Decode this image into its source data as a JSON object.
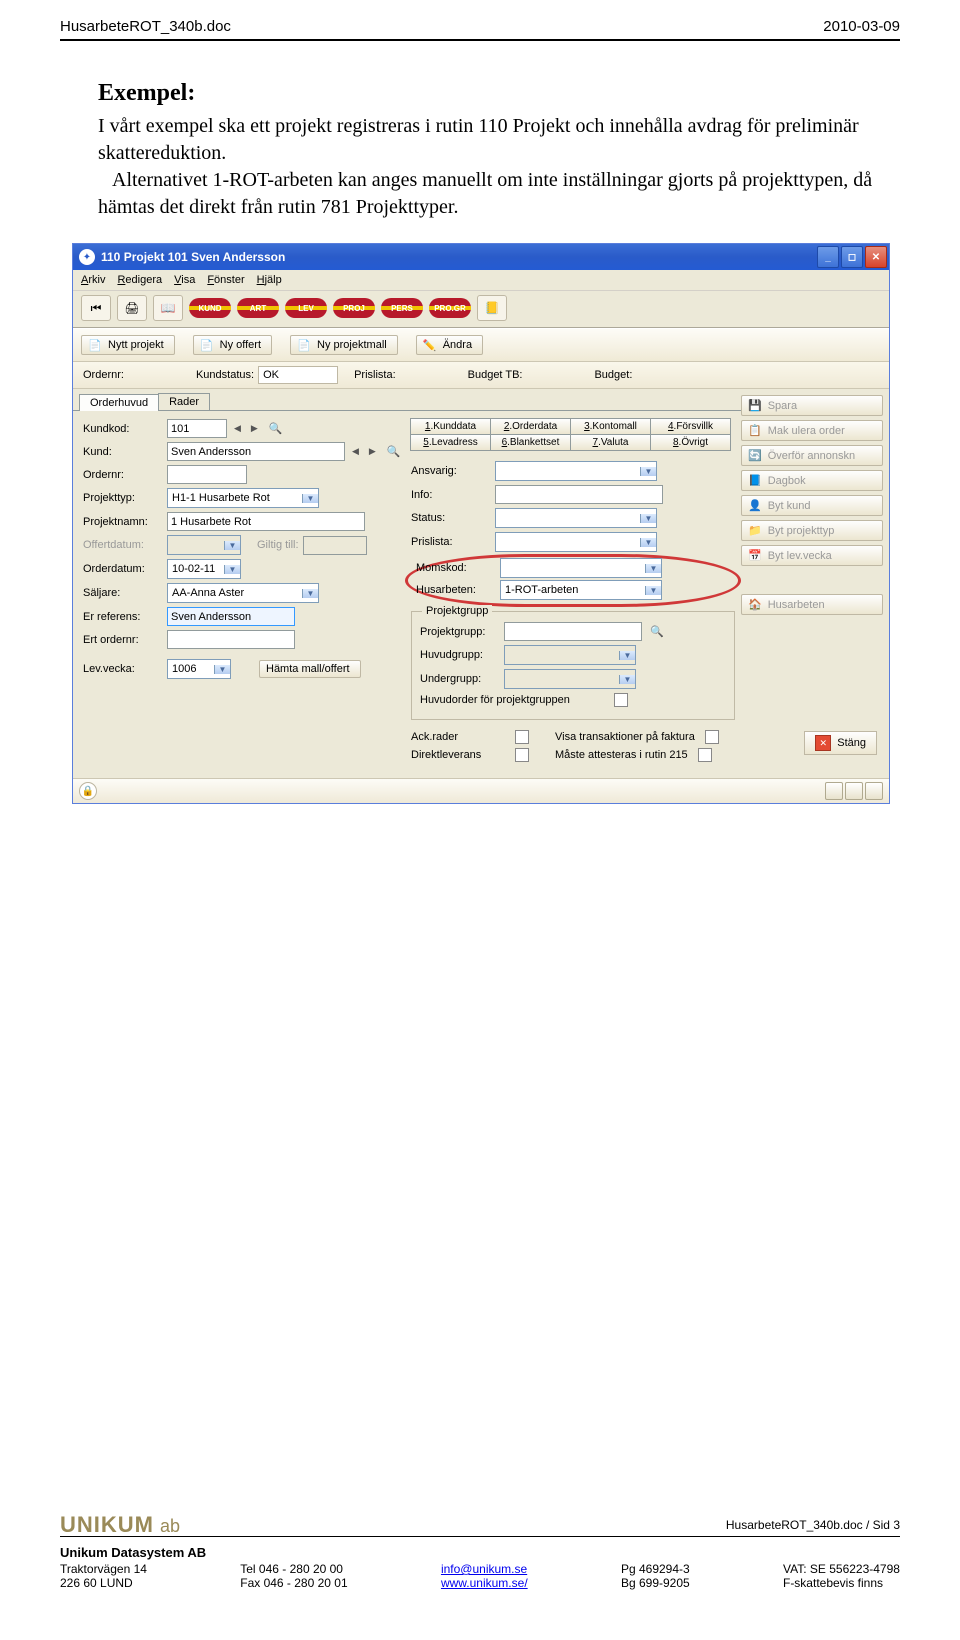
{
  "header": {
    "left": "HusarbeteROT_340b.doc",
    "right": "2010-03-09"
  },
  "text": {
    "heading": "Exempel:",
    "p1": "I vårt exempel ska ett projekt registreras i rutin 110 Projekt och innehålla avdrag för preliminär skattereduktion.",
    "p2a": "Alternativet 1-ROT-arbeten kan anges manuellt om inte inställningar gjorts på projekttypen, då hämtas det direkt från rutin 781 Projekttyper."
  },
  "window": {
    "title": "110 Projekt  101  Sven Andersson",
    "menu": [
      "Arkiv",
      "Redigera",
      "Visa",
      "Fönster",
      "Hjälp"
    ],
    "pills": [
      "KUND",
      "ART",
      "LEV",
      "PROJ",
      "PERS",
      "PRO.GR"
    ],
    "toolbar_buttons": [
      {
        "icon": "📄",
        "label": "Nytt projekt"
      },
      {
        "icon": "📄",
        "label": "Ny offert"
      },
      {
        "icon": "📄",
        "label": "Ny projektmall"
      },
      {
        "icon": "✏️",
        "label": "Ändra"
      }
    ],
    "meta": {
      "ordernr_label": "Ordernr:",
      "kundstatus_label": "Kundstatus:",
      "kundstatus": "OK",
      "prislista_label": "Prislista:",
      "budgettb_label": "Budget TB:",
      "budget_label": "Budget:"
    },
    "tabs": [
      "Orderhuvud",
      "Rader"
    ],
    "left": {
      "kundkod_label": "Kundkod:",
      "kundkod": "101",
      "kund_label": "Kund:",
      "kund": "Sven Andersson",
      "ordernr_label": "Ordernr:",
      "projekttyp_label": "Projekttyp:",
      "projekttyp": "H1-1 Husarbete Rot",
      "projektnamn_label": "Projektnamn:",
      "projektnamn": "1 Husarbete Rot",
      "offertdatum_label": "Offertdatum:",
      "giltig_label": "Giltig till:",
      "orderdatum_label": "Orderdatum:",
      "orderdatum": "10-02-11",
      "saljare_label": "Säljare:",
      "saljare": "AA-Anna Aster",
      "erref_label": "Er referens:",
      "erref": "Sven Andersson",
      "ertorder_label": "Ert ordernr:",
      "lev_label": "Lev.vecka:",
      "lev": "1006",
      "hamta_btn": "Hämta mall/offert"
    },
    "gridtabs": [
      "1.Kunddata",
      "2.Orderdata",
      "3.Kontomall",
      "4.Försvillk",
      "5.Levadress",
      "6.Blankettset",
      "7.Valuta",
      "8.Övrigt"
    ],
    "mid": {
      "ansvarig_label": "Ansvarig:",
      "info_label": "Info:",
      "status_label": "Status:",
      "prislista_label": "Prislista:",
      "momskod_label": "Momskod:",
      "husarbeten_label": "Husarbeten:",
      "husarbeten": "1-ROT-arbeten",
      "fs_title": "Projektgrupp",
      "projektgrupp_label": "Projektgrupp:",
      "huvudgrupp_label": "Huvudgrupp:",
      "undergrupp_label": "Undergrupp:",
      "huvudorder_label": "Huvudorder för projektgruppen",
      "ack_label": "Ack.rader",
      "visa_label": "Visa transaktioner på faktura",
      "direkt_label": "Direktleverans",
      "maste_label": "Måste attesteras i rutin 215"
    },
    "side": [
      {
        "icon": "💾",
        "label": "Spara"
      },
      {
        "icon": "📋",
        "label": "Mak ulera order"
      },
      {
        "icon": "🔄",
        "label": "Överför annonskn"
      },
      {
        "icon": "📘",
        "label": "Dagbok"
      },
      {
        "icon": "👤",
        "label": "Byt kund"
      },
      {
        "icon": "📁",
        "label": "Byt projekttyp"
      },
      {
        "icon": "📅",
        "label": "Byt lev.vecka"
      },
      {
        "icon": "🏠",
        "label": "Husarbeten"
      }
    ],
    "stang": "Stäng"
  },
  "footer": {
    "sidref": "HusarbeteROT_340b.doc / Sid 3",
    "company": "Unikum Datasystem AB",
    "addr1": "Traktorvägen 14",
    "addr2": "226 60  LUND",
    "tel": "Tel  046 - 280 20 00",
    "fax": "Fax  046 - 280 20 01",
    "mail": "info@unikum.se",
    "web": "www.unikum.se/",
    "pg": "Pg  469294-3",
    "bg": "Bg  699-9205",
    "vat": "VAT: SE 556223-4798",
    "fs": "F-skattebevis finns",
    "logo": "UNIKUM",
    "logo_ab": "ab"
  }
}
